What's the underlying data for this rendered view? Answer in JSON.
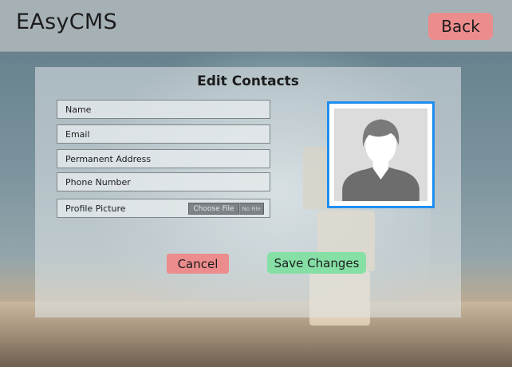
{
  "app": {
    "title": "EAsyCMS",
    "back_label": "Back"
  },
  "form": {
    "title": "Edit Contacts",
    "fields": {
      "name_placeholder": "Name",
      "email_placeholder": "Email",
      "address_placeholder": "Permanent Address",
      "phone_placeholder": "Phone Number",
      "profile_label": "Profile Picture"
    },
    "file": {
      "choose_label": "Choose File",
      "status": "No File"
    },
    "cancel_label": "Cancel",
    "save_label": "Save Changes"
  },
  "avatar": {
    "icon": "default-user-avatar-icon"
  },
  "colors": {
    "topbar": "#a6b1b6",
    "cancel": "#ec8c8c",
    "save": "#86e0a6",
    "avatar_border": "#1f8ef0"
  }
}
